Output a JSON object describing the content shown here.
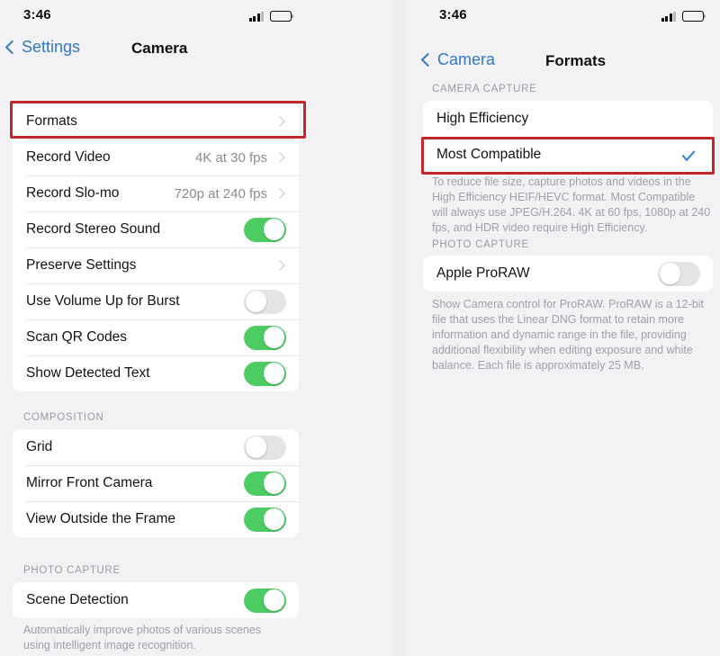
{
  "left_screen": {
    "status_bar": {
      "time": "3:46",
      "signal_icon": "cellular-signal-icon",
      "battery_icon": "battery-full-icon"
    },
    "nav": {
      "back_label": "Settings",
      "title": "Camera",
      "back_icon": "chevron-left-icon"
    },
    "sections": [
      {
        "header": "",
        "rows": [
          {
            "label": "Formats",
            "value": "",
            "control": "chevron",
            "highlighted": true
          },
          {
            "label": "Record Video",
            "value": "4K at 30 fps",
            "control": "chevron"
          },
          {
            "label": "Record Slo-mo",
            "value": "720p at 240 fps",
            "control": "chevron"
          },
          {
            "label": "Record Stereo Sound",
            "value": "",
            "control": "toggle",
            "toggle_on": true
          },
          {
            "label": "Preserve Settings",
            "value": "",
            "control": "chevron"
          },
          {
            "label": "Use Volume Up for Burst",
            "value": "",
            "control": "toggle",
            "toggle_on": false
          },
          {
            "label": "Scan QR Codes",
            "value": "",
            "control": "toggle",
            "toggle_on": true
          },
          {
            "label": "Show Detected Text",
            "value": "",
            "control": "toggle",
            "toggle_on": true
          }
        ]
      },
      {
        "header": "COMPOSITION",
        "rows": [
          {
            "label": "Grid",
            "value": "",
            "control": "toggle",
            "toggle_on": false
          },
          {
            "label": "Mirror Front Camera",
            "value": "",
            "control": "toggle",
            "toggle_on": true
          },
          {
            "label": "View Outside the Frame",
            "value": "",
            "control": "toggle",
            "toggle_on": true
          }
        ]
      },
      {
        "header": "PHOTO CAPTURE",
        "rows": [
          {
            "label": "Scene Detection",
            "value": "",
            "control": "toggle",
            "toggle_on": true
          }
        ],
        "footnote": "Automatically improve photos of various scenes using intelligent image recognition."
      }
    ]
  },
  "right_screen": {
    "status_bar": {
      "time": "3:46",
      "signal_icon": "cellular-signal-icon",
      "battery_icon": "battery-full-icon"
    },
    "nav": {
      "back_label": "Camera",
      "title": "Formats",
      "back_icon": "chevron-left-icon"
    },
    "camera_capture": {
      "header": "CAMERA CAPTURE",
      "options": [
        {
          "label": "High Efficiency",
          "selected": false,
          "highlighted": false
        },
        {
          "label": "Most Compatible",
          "selected": true,
          "highlighted": true
        }
      ],
      "footnote": "To reduce file size, capture photos and videos in the High Efficiency HEIF/HEVC format. Most Compatible will always use JPEG/H.264. 4K at 60 fps, 1080p at 240 fps, and HDR video require High Efficiency."
    },
    "photo_capture": {
      "header": "PHOTO CAPTURE",
      "rows": [
        {
          "label": "Apple ProRAW",
          "control": "toggle",
          "toggle_on": false
        }
      ],
      "footnote": "Show Camera control for ProRAW. ProRAW is a 12-bit file that uses the Linear DNG format to retain more information and dynamic range in the file, providing additional flexibility when editing exposure and white balance. Each file is approximately 25 MB."
    }
  },
  "colors": {
    "accent_blue": "#3479c0",
    "toggle_on_green": "#4ccc63",
    "toggle_off_gray": "#e4e4e7",
    "highlight_red": "#c0282d",
    "checkmark_blue": "#2f7fd6",
    "page_background": "#f2f2f5",
    "card_background": "#ffffff"
  }
}
